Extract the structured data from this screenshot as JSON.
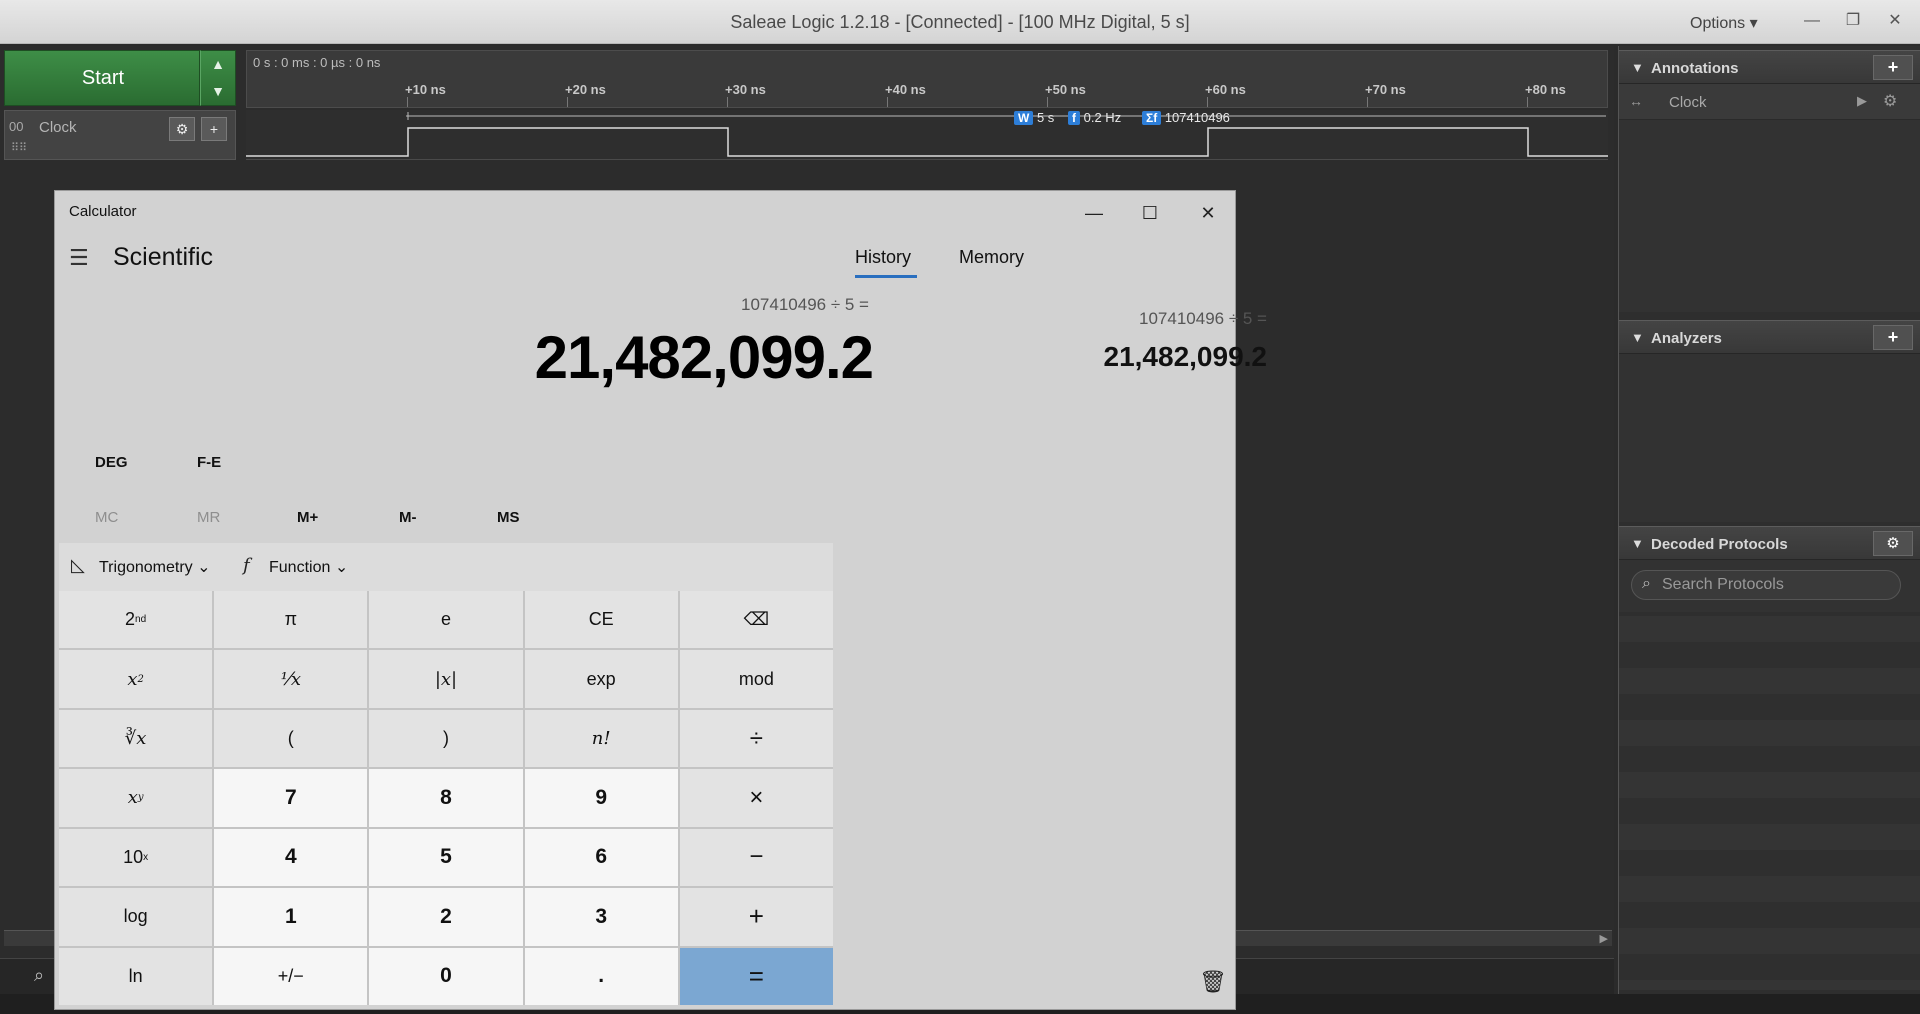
{
  "saleae": {
    "title": "Saleae Logic 1.2.18 - [Connected] - [100 MHz Digital, 5 s]",
    "options_label": "Options ▾",
    "start_label": "Start",
    "timecode": "0 s : 0 ms : 0 µs : 0 ns",
    "ruler_ticks": [
      "+10 ns",
      "+20 ns",
      "+30 ns",
      "+40 ns",
      "+50 ns",
      "+60 ns",
      "+70 ns",
      "+80 ns"
    ],
    "channel": {
      "number": "00",
      "name": "Clock"
    },
    "measurements": {
      "width_tag": "W",
      "width_value": "5 s",
      "freq_tag": "f",
      "freq_value": "0.2 Hz",
      "count_tag": "Σf",
      "count_value": "107410496"
    }
  },
  "panels": {
    "annotations": {
      "title": "Annotations",
      "row_name": "Clock"
    },
    "analyzers": {
      "title": "Analyzers"
    },
    "decoded_protocols": {
      "title": "Decoded Protocols",
      "search_placeholder": "Search Protocols"
    }
  },
  "calculator": {
    "window_title": "Calculator",
    "mode": "Scientific",
    "expression": "107410496 ÷ 5 =",
    "display": "21,482,099.2",
    "angle_mode": "DEG",
    "fe_label": "F-E",
    "memory_buttons": [
      "MC",
      "MR",
      "M+",
      "M-",
      "MS"
    ],
    "trig_label": "Trigonometry",
    "function_label": "Function",
    "tabs": {
      "history": "History",
      "memory": "Memory"
    },
    "history": {
      "expression": "107410496  ÷  5 =",
      "result": "21,482,099.2"
    },
    "keys": {
      "second": "2",
      "pi": "π",
      "e": "e",
      "ce": "CE",
      "back": "⌫",
      "square": "x",
      "reciprocal": "⅟x",
      "abs": "|x|",
      "exp": "exp",
      "mod": "mod",
      "sqrt": "∛x",
      "lparen": "(",
      "rparen": ")",
      "fact": "n!",
      "divide": "÷",
      "pow": "x",
      "n7": "7",
      "n8": "8",
      "n9": "9",
      "multiply": "×",
      "tenpow": "10",
      "n4": "4",
      "n5": "5",
      "n6": "6",
      "minus": "−",
      "log": "log",
      "n1": "1",
      "n2": "2",
      "n3": "3",
      "plus": "+",
      "ln": "ln",
      "negate": "+/−",
      "n0": "0",
      "dot": ".",
      "equals": "="
    }
  }
}
